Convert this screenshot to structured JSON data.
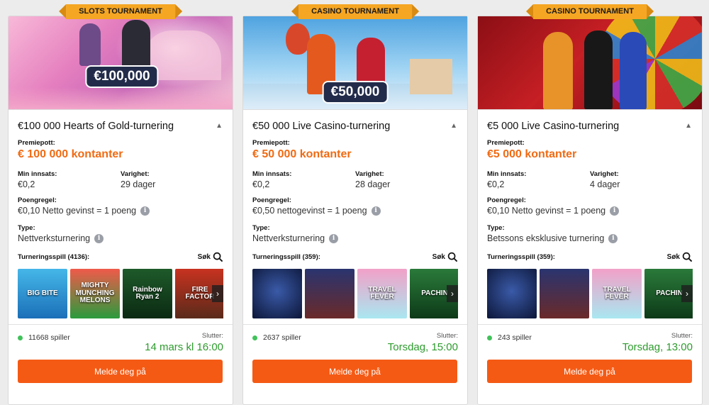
{
  "cards": [
    {
      "ribbon": "SLOTS TOURNAMENT",
      "hero_prize": "€100,000",
      "title": "€100 000 Hearts of Gold-turnering",
      "prize_label": "Premiepott:",
      "prize": "€ 100 000 kontanter",
      "min_bet_label": "Min innsats:",
      "min_bet": "€0,2",
      "duration_label": "Varighet:",
      "duration": "29 dager",
      "points_label": "Poengregel:",
      "points": "€0,10 Netto gevinst = 1 poeng",
      "type_label": "Type:",
      "type": "Nettverksturnering",
      "games_label": "Turneringsspill (4136):",
      "search_label": "Søk",
      "games": [
        "BIG BITE",
        "MIGHTY MUNCHING MELONS",
        "Rainbow Ryan 2",
        "FIRE FACTOR"
      ],
      "players": "11668 spiller",
      "ends_label": "Slutter:",
      "ends": "14 mars kl 16:00",
      "cta": "Melde deg på"
    },
    {
      "ribbon": "CASINO TOURNAMENT",
      "hero_prize": "€50,000",
      "title": "€50 000 Live Casino-turnering",
      "prize_label": "Premiepott:",
      "prize": "€ 50 000 kontanter",
      "min_bet_label": "Min innsats:",
      "min_bet": "€0,2",
      "duration_label": "Varighet:",
      "duration": "28 dager",
      "points_label": "Poengregel:",
      "points": "€0,50 nettogevinst = 1 poeng",
      "type_label": "Type:",
      "type": "Nettverksturnering",
      "games_label": "Turneringsspill (359):",
      "search_label": "Søk",
      "games": [
        "",
        "",
        "TRAVEL FEVER",
        "PACHIN"
      ],
      "players": "2637 spiller",
      "ends_label": "Slutter:",
      "ends": "Torsdag, 15:00",
      "cta": "Melde deg på"
    },
    {
      "ribbon": "CASINO TOURNAMENT",
      "hero_prize": "",
      "title": "€5 000 Live Casino-turnering",
      "prize_label": "Premiepott:",
      "prize": "€5 000 kontanter",
      "min_bet_label": "Min innsats:",
      "min_bet": "€0,2",
      "duration_label": "Varighet:",
      "duration": "4 dager",
      "points_label": "Poengregel:",
      "points": "€0,10 Netto gevinst = 1 poeng",
      "type_label": "Type:",
      "type": "Betssons eksklusive turnering",
      "games_label": "Turneringsspill (359):",
      "search_label": "Søk",
      "games": [
        "",
        "",
        "TRAVEL FEVER",
        "PACHIN"
      ],
      "players": "243 spiller",
      "ends_label": "Slutter:",
      "ends": "Torsdag, 13:00",
      "cta": "Melde deg på"
    }
  ],
  "icons": {
    "chevron": "chevron-up-icon",
    "info": "info-icon",
    "search": "magnifier-icon",
    "next": "chevron-right-icon",
    "status": "online-dot-icon"
  },
  "colors": {
    "ribbon": "#f5a623",
    "prize": "#f06a12",
    "ends": "#2e9b2e",
    "cta": "#f55a14",
    "status_dot": "#41c15a"
  }
}
